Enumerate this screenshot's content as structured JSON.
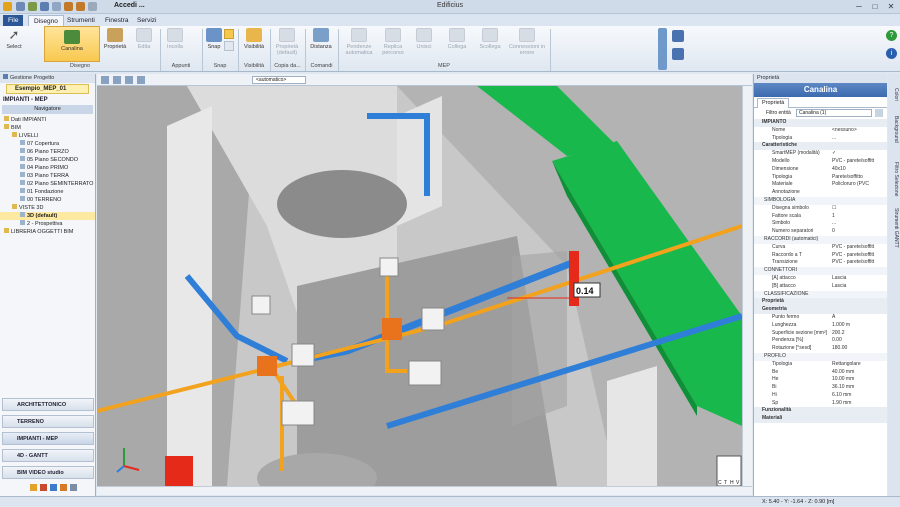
{
  "window": {
    "app_title": "Edificius",
    "project_short": "Accedi ...",
    "controls": [
      "─",
      "□",
      "✕"
    ]
  },
  "menu_tabs": [
    "File",
    "Disegno",
    "Strumenti",
    "Finestra",
    "Servizi"
  ],
  "ribbon": {
    "select": "Select",
    "canalina": "Canalina",
    "proprieta": "Proprietà",
    "edita": "Edita",
    "incolla": "Incolla",
    "snap": "Snap",
    "visibilita": "Visibilità",
    "proprieta_default": "Proprietà (default)",
    "distanza": "Distanza",
    "pendenza": "Pendenze automatica",
    "replica": "Replica percorso",
    "unisci": "Unisci",
    "collega": "Collega",
    "scollega": "Scollega",
    "connessioni": "Connessioni in errore",
    "groups": {
      "disegno": "Disegno",
      "appunti": "Appunti",
      "snap": "Snap",
      "visibilita": "Visibilità",
      "copia": "Copia da...",
      "comandi": "Comandi",
      "mep": "MEP"
    }
  },
  "left": {
    "panel_title": "Gestione Progetto",
    "project": "Esempio_MEP_01",
    "section": "IMPIANTI - MEP",
    "navigator": "Navigatore",
    "tree": [
      {
        "label": "Dati IMPIANTI",
        "indent": 0
      },
      {
        "label": "BIM",
        "indent": 0
      },
      {
        "label": "LIVELLI",
        "indent": 1
      },
      {
        "label": "07 Copertura",
        "indent": 2
      },
      {
        "label": "06 Piano TERZO",
        "indent": 2
      },
      {
        "label": "05 Piano SECONDO",
        "indent": 2
      },
      {
        "label": "04 Piano PRIMO",
        "indent": 2
      },
      {
        "label": "03 Piano TERRA",
        "indent": 2
      },
      {
        "label": "02 Piano SEMINTERRATO",
        "indent": 2
      },
      {
        "label": "01 Fondazione",
        "indent": 2
      },
      {
        "label": "00 TERRENO",
        "indent": 2
      },
      {
        "label": "VISTE 3D",
        "indent": 1
      },
      {
        "label": "3D (default)",
        "indent": 2,
        "selected": true
      },
      {
        "label": "2 - Prospettiva",
        "indent": 2
      },
      {
        "label": "LIBRERIA OGGETTI BIM",
        "indent": 0
      }
    ],
    "views": [
      "ARCHITETTONICO",
      "TERRENO",
      "IMPIANTI - MEP",
      "4D - GANTT",
      "BIM VIDEO studio"
    ]
  },
  "viewport": {
    "mode": "<automatico>",
    "measure": "0.14",
    "cube": [
      "C",
      "T",
      "H",
      "V"
    ]
  },
  "right": {
    "panel_title": "Proprietà",
    "object": "Canalina",
    "tab": "Proprietà",
    "filter_label": "Filtro entità",
    "filter_value": "Canalina (1)",
    "rows": [
      {
        "type": "sec",
        "k": "IMPIANTO"
      },
      {
        "k": "Nome",
        "v": "<nessuno>"
      },
      {
        "k": "Tipologia",
        "v": "..."
      },
      {
        "type": "sec",
        "k": "Caratteristiche"
      },
      {
        "k": "SmartMEP (modalità)",
        "v": "✓"
      },
      {
        "k": "Modello",
        "v": "PVC - parete/soffitt"
      },
      {
        "k": "Dimensione",
        "v": "40x10"
      },
      {
        "k": "Tipologia",
        "v": "Parete/soffitto"
      },
      {
        "k": "Materiale",
        "v": "Policloruro (PVC"
      },
      {
        "k": "Annotazione",
        "v": ""
      },
      {
        "type": "sub",
        "k": "SIMBOLOGIA"
      },
      {
        "k": "Disegna simbolo",
        "v": "☐"
      },
      {
        "k": "Fattore scala",
        "v": "1"
      },
      {
        "k": "Simbolo",
        "v": "..."
      },
      {
        "k": "Numero separatori",
        "v": "0"
      },
      {
        "type": "sub",
        "k": "RACCORDI (automatici)"
      },
      {
        "k": "Curva",
        "v": "PVC - parete/soffitt"
      },
      {
        "k": "Raccordo a T",
        "v": "PVC - parete/soffitt"
      },
      {
        "k": "Transizione",
        "v": "PVC - parete/soffitt"
      },
      {
        "type": "sub",
        "k": "CONNETTORI"
      },
      {
        "k": "[A] attacco",
        "v": "Lascia"
      },
      {
        "k": "[B] attacco",
        "v": "Lascia"
      },
      {
        "type": "sub",
        "k": "CLASSIFICAZIONE"
      },
      {
        "type": "sec",
        "k": "Proprietà"
      },
      {
        "type": "sec",
        "k": "Geometria"
      },
      {
        "k": "Punto fermo",
        "v": "A"
      },
      {
        "k": "Lunghezza",
        "v": "1.000 m"
      },
      {
        "k": "Superficie sezione [mm²]",
        "v": "200.2"
      },
      {
        "k": "Pendenza [%]",
        "v": "0.00"
      },
      {
        "k": "Rotazione [°sesd]",
        "v": "180.00"
      },
      {
        "type": "sub",
        "k": "PROFILO"
      },
      {
        "k": "Tipologia",
        "v": "Rettangolare"
      },
      {
        "k": "Be",
        "v": "40.00 mm"
      },
      {
        "k": "He",
        "v": "10.00 mm"
      },
      {
        "k": "Bi",
        "v": "36.10 mm"
      },
      {
        "k": "Hi",
        "v": "6.10 mm"
      },
      {
        "k": "Sp",
        "v": "1.90 mm"
      },
      {
        "type": "sec",
        "k": "Funzionalità"
      },
      {
        "type": "sec",
        "k": "Materiali"
      }
    ],
    "side_tabs": [
      "Colori",
      "Background",
      "Filtro Selezione",
      "Strumenti GANTT"
    ]
  },
  "status": {
    "coords": "X: 5.40 - Y: -1.64 - Z: 0.90 [m]"
  },
  "colors": {
    "accent": "#2b5797",
    "duct_green": "#19b84c",
    "pipe_blue": "#2f7fd8",
    "pipe_orange": "#f2a21c",
    "red_box": "#e52a1a"
  }
}
